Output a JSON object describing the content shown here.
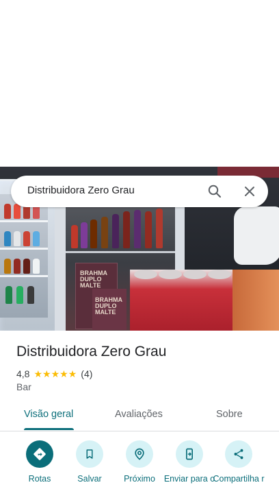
{
  "search": {
    "query": "Distribuidora Zero Grau"
  },
  "place": {
    "name": "Distribuidora Zero Grau",
    "rating": "4,8",
    "stars": [
      "★",
      "★",
      "★",
      "★",
      "★"
    ],
    "review_count": "(4)",
    "category": "Bar"
  },
  "photo": {
    "case_text_1": "BRAHMA DUPLO MALTE",
    "case_text_2": "BRAHMA DUPLO MALTE"
  },
  "tabs": [
    {
      "label": "Visão geral",
      "active": true
    },
    {
      "label": "Avaliações",
      "active": false
    },
    {
      "label": "Sobre",
      "active": false
    }
  ],
  "actions": [
    {
      "label": "Rotas",
      "icon": "directions-icon"
    },
    {
      "label": "Salvar",
      "icon": "bookmark-icon"
    },
    {
      "label": "Próximo",
      "icon": "nearby-icon"
    },
    {
      "label": "Enviar para o",
      "icon": "send-to-phone-icon"
    },
    {
      "label": "Compartilha r",
      "icon": "share-icon"
    }
  ],
  "colors": {
    "accent": "#0b6e7a",
    "accent_light": "#d6f2f6",
    "star": "#fbbc04"
  }
}
